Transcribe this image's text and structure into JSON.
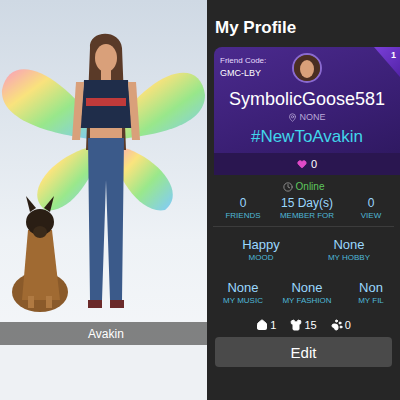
{
  "scene": {
    "avatar_name": "Avakin"
  },
  "header": {
    "title": "My Profile"
  },
  "card": {
    "friend_code_label": "Friend Code:",
    "friend_code": "GMC-LBY",
    "level": "1",
    "username": "SymbolicGoose581",
    "location": "NONE",
    "tag": "#NewToAvakin",
    "likes": "0"
  },
  "status": "Online",
  "stats": [
    {
      "value": "0",
      "label": "FRIENDS"
    },
    {
      "value": "15 Day(s)",
      "label": "MEMBER FOR"
    },
    {
      "value": "0",
      "label": "VIEW"
    }
  ],
  "about_rows": [
    [
      {
        "value": "Happy",
        "label": "MOOD"
      },
      {
        "value": "None",
        "label": "MY HOBBY"
      }
    ],
    [
      {
        "value": "None",
        "label": "MY MUSIC"
      },
      {
        "value": "None",
        "label": "MY FASHION"
      },
      {
        "value": "Non",
        "label": "MY FIL"
      }
    ]
  ],
  "counts": [
    {
      "kind": "house",
      "value": "1"
    },
    {
      "kind": "shirt",
      "value": "15"
    },
    {
      "kind": "paw",
      "value": "0"
    }
  ],
  "edit_button": "Edit"
}
